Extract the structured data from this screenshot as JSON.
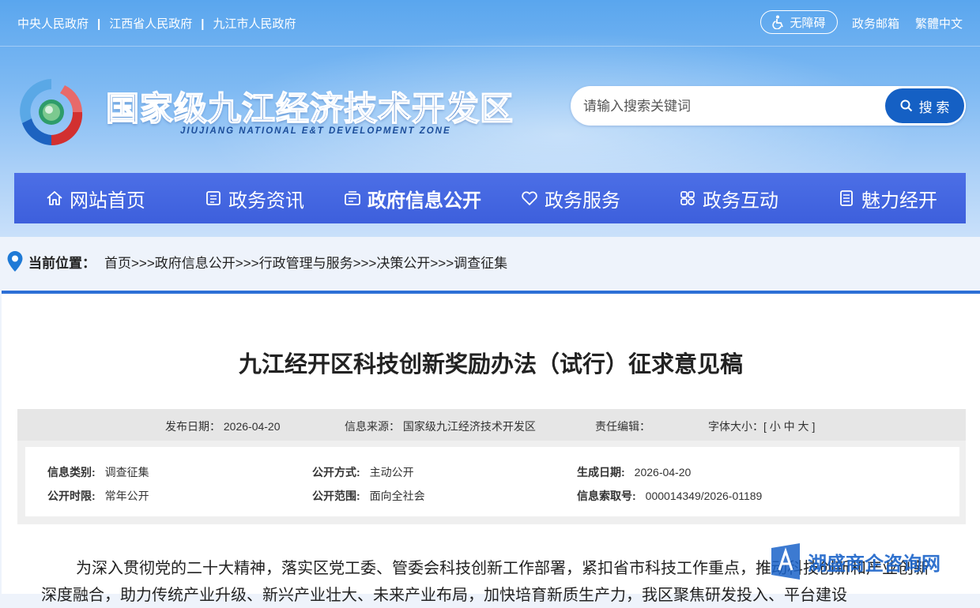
{
  "topbar": {
    "links": [
      "中央人民政府",
      "江西省人民政府",
      "九江市人民政府"
    ],
    "separator": "|",
    "accessibility_label": "无障碍",
    "mail_label": "政务邮箱",
    "traditional_label": "繁體中文"
  },
  "brand": {
    "title": "国家级九江经济技术开发区",
    "subtitle": "JIUJIANG NATIONAL E&T DEVELOPMENT ZONE"
  },
  "search": {
    "placeholder": "请输入搜索关键词",
    "button_label": "搜 索"
  },
  "nav": {
    "items": [
      {
        "label": "网站首页",
        "icon": "home-icon"
      },
      {
        "label": "政务资讯",
        "icon": "news-icon"
      },
      {
        "label": "政府信息公开",
        "icon": "info-open-icon",
        "active": true
      },
      {
        "label": "政务服务",
        "icon": "heart-icon"
      },
      {
        "label": "政务互动",
        "icon": "interaction-icon"
      },
      {
        "label": "魅力经开",
        "icon": "document-icon"
      }
    ]
  },
  "breadcrumb": {
    "label": "当前位置：",
    "path": "首页>>>政府信息公开>>>行政管理与服务>>>决策公开>>>调查征集"
  },
  "article": {
    "title": "九江经开区科技创新奖励办法（试行）征求意见稿",
    "meta": {
      "publish_date": "发布日期：  2026-04-20",
      "source": "信息来源：  国家级九江经济技术开发区",
      "editor": "责任编辑：",
      "font_size": "字体大小：[ 小 中 大 ]"
    },
    "info": {
      "category_label": "信息类别:",
      "category_value": "调查征集",
      "method_label": "公开方式:",
      "method_value": "主动公开",
      "generated_label": "生成日期:",
      "generated_value": "2026-04-20",
      "period_label": "公开时限:",
      "period_value": "常年公开",
      "scope_label": "公开范围:",
      "scope_value": "面向全社会",
      "index_label": "信息索取号:",
      "index_value": "000014349/2026-01189"
    },
    "body": "为深入贯彻党的二十大精神，落实区党工委、管委会科技创新工作部署，紧扣省市科技工作重点，推动科技创新和产业创新深度融合，助力传统产业升级、新兴产业壮大、未来产业布局，加快培育新质生产力，我区聚焦研发投入、平台建设"
  },
  "watermark": {
    "text": "湖盛商企咨询网"
  },
  "colors": {
    "nav_bg": "#4268e0",
    "accent": "#1560c4",
    "content_border": "#2d6fd6"
  }
}
